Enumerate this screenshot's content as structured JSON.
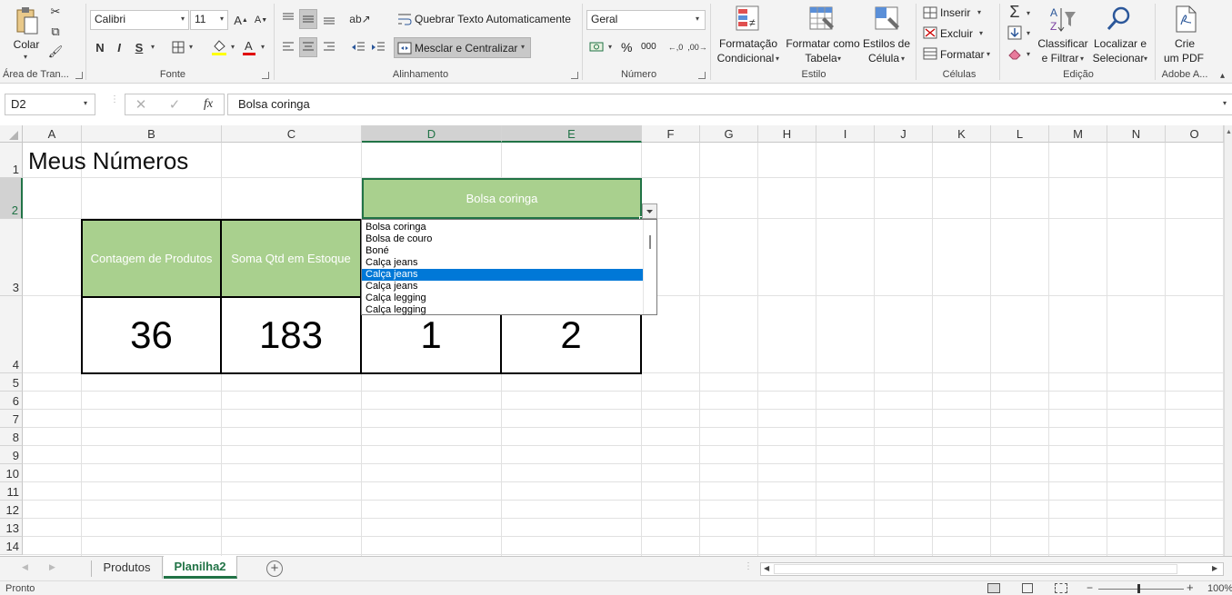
{
  "ribbon": {
    "clipboard": {
      "paste_label": "Colar",
      "group_label": "Área de Tran..."
    },
    "font": {
      "font_name": "Calibri",
      "font_size": "11",
      "bold": "N",
      "italic": "I",
      "underline": "S",
      "group_label": "Fonte"
    },
    "alignment": {
      "wrap_text": "Quebrar Texto Automaticamente",
      "merge_center": "Mesclar e Centralizar",
      "group_label": "Alinhamento"
    },
    "number": {
      "format": "Geral",
      "percent": "%",
      "thousands": "000",
      "group_label": "Número"
    },
    "styles": {
      "conditional_1": "Formatação",
      "conditional_2": "Condicional",
      "format_table_1": "Formatar como",
      "format_table_2": "Tabela",
      "cell_styles_1": "Estilos de",
      "cell_styles_2": "Célula",
      "group_label": "Estilo"
    },
    "cells": {
      "insert": "Inserir",
      "delete": "Excluir",
      "format": "Formatar",
      "group_label": "Células"
    },
    "editing": {
      "sort_1": "Classificar",
      "sort_2": "e Filtrar",
      "find_1": "Localizar e",
      "find_2": "Selecionar",
      "group_label": "Edição"
    },
    "adobe": {
      "pdf_1": "Crie",
      "pdf_2": "um PDF",
      "group_label": "Adobe A..."
    }
  },
  "formula_bar": {
    "name_box": "D2",
    "fx": "fx",
    "value": "Bolsa coringa"
  },
  "columns": [
    "A",
    "B",
    "C",
    "D",
    "E",
    "F",
    "G",
    "H",
    "I",
    "J",
    "K",
    "L",
    "M",
    "N",
    "O"
  ],
  "rows": [
    "1",
    "2",
    "3",
    "4",
    "5",
    "6",
    "7",
    "8",
    "9",
    "10",
    "11",
    "12",
    "13",
    "14"
  ],
  "cells": {
    "a1": "Meus Números",
    "d2": "Bolsa coringa",
    "b3": "Contagem de Produtos",
    "c3": "Soma Qtd em Estoque",
    "b4": "36",
    "c4": "183",
    "d4": "1",
    "e4": "2"
  },
  "dropdown": {
    "options": [
      "Bolsa coringa",
      "Bolsa de couro",
      "Boné",
      "Calça jeans",
      "Calça jeans",
      "Calça jeans",
      "Calça legging",
      "Calça legging"
    ],
    "selected_index": 4
  },
  "sheet_tabs": [
    "Produtos",
    "Planilha2"
  ],
  "active_tab": "Planilha2",
  "status": {
    "ready": "Pronto",
    "zoom": "100%"
  },
  "colors": {
    "green_fill": "#a9d08e",
    "excel_green": "#217346",
    "selection_blue": "#0078d7"
  }
}
